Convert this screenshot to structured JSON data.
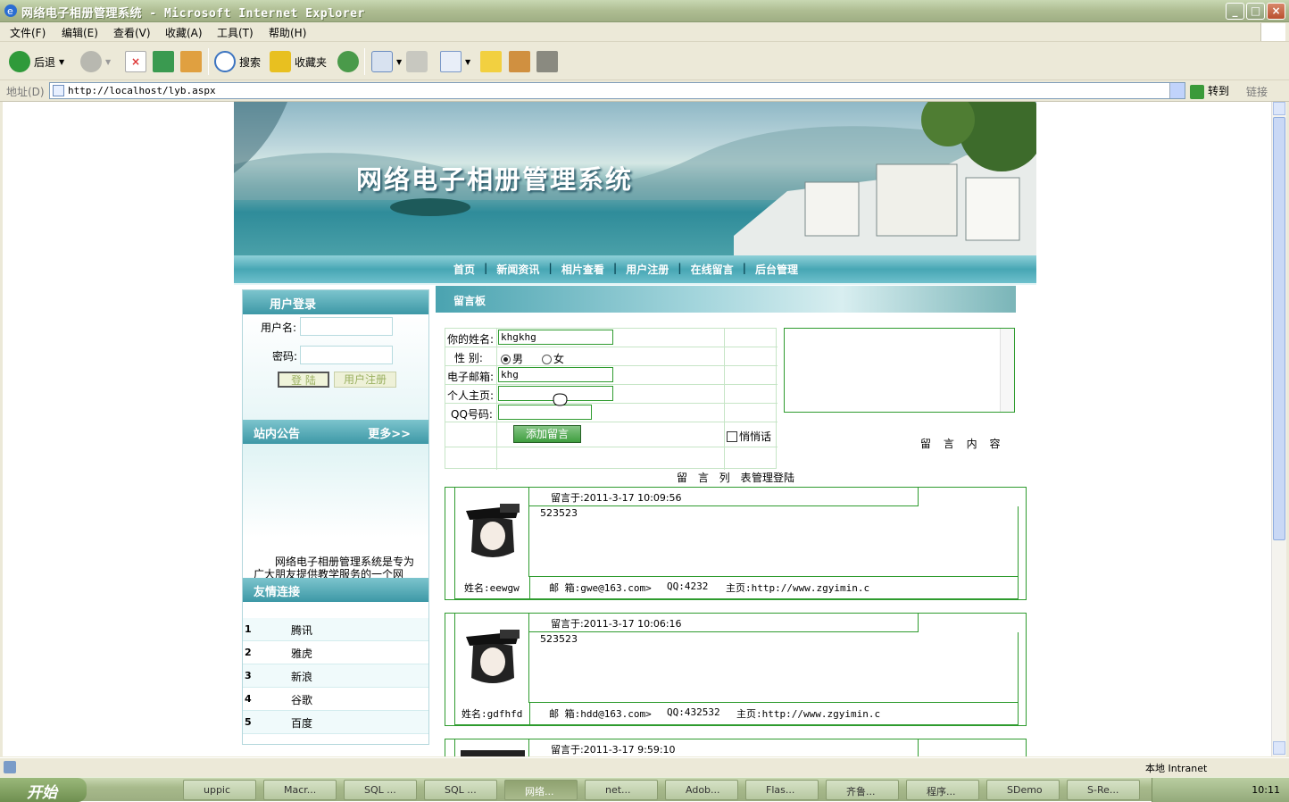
{
  "window": {
    "title": "网络电子相册管理系统 - Microsoft Internet Explorer"
  },
  "menu": [
    "文件(F)",
    "编辑(E)",
    "查看(V)",
    "收藏(A)",
    "工具(T)",
    "帮助(H)"
  ],
  "toolbar": {
    "back": "后退",
    "search": "搜索",
    "favorites": "收藏夹"
  },
  "address": {
    "label": "地址(D)",
    "url": "http://localhost/lyb.aspx",
    "go": "转到",
    "links": "链接"
  },
  "site": {
    "banner_title": "网络电子相册管理系统",
    "nav": [
      "首页",
      "新闻资讯",
      "相片查看",
      "用户注册",
      "在线留言",
      "后台管理"
    ]
  },
  "login": {
    "header": "用户登录",
    "username_label": "用户名:",
    "password_label": "密码:",
    "login_button": "登 陆",
    "register_button": "用户注册"
  },
  "notice": {
    "header": "站内公告",
    "more": "更多>>",
    "text": "网络电子相册管理系统是专为广大朋友提供教学服务的一个网"
  },
  "friendlinks": {
    "header": "友情连接",
    "items": [
      {
        "n": "1",
        "t": "腾讯"
      },
      {
        "n": "2",
        "t": "雅虎"
      },
      {
        "n": "3",
        "t": "新浪"
      },
      {
        "n": "4",
        "t": "谷歌"
      },
      {
        "n": "5",
        "t": "百度"
      }
    ]
  },
  "board": {
    "header": "留言板",
    "name_label": "你的姓名:",
    "name_value": "khgkhg",
    "gender_label": "性 别:",
    "male": "男",
    "female": "女",
    "email_label": "电子邮箱:",
    "email_value": "khg",
    "home_label": "个人主页:",
    "qq_label": "QQ号码:",
    "submit": "添加留言",
    "quiet": "悄悄话",
    "content_label": "留 言 内 容",
    "list_title": "留 言 列 表",
    "admin_link": "管理登陆"
  },
  "messages": [
    {
      "when": "留言于:2011-3-17 10:09:56",
      "body": "523523",
      "name": "姓名:eewgw",
      "email": "邮 箱:gwe@163.com>",
      "qq": "QQ:4232",
      "home": "主页:http://www.zgyimin.c"
    },
    {
      "when": "留言于:2011-3-17 10:06:16",
      "body": "523523",
      "name": "姓名:gdfhfd",
      "email": "邮 箱:hdd@163.com>",
      "qq": "QQ:432532",
      "home": "主页:http://www.zgyimin.c"
    },
    {
      "when": "留言于:2011-3-17 9:59:10",
      "body": "",
      "name": "",
      "email": "",
      "qq": "",
      "home": ""
    }
  ],
  "statusbar": {
    "zone": "本地 Intranet"
  },
  "taskbar": {
    "start": "开始",
    "tasks": [
      "uppic",
      "Macr...",
      "SQL ...",
      "SQL ...",
      "网络...",
      "net...",
      "Adob...",
      "Flas...",
      "齐鲁...",
      "程序...",
      "SDemo",
      "S-Re..."
    ],
    "clock": "10:11"
  }
}
